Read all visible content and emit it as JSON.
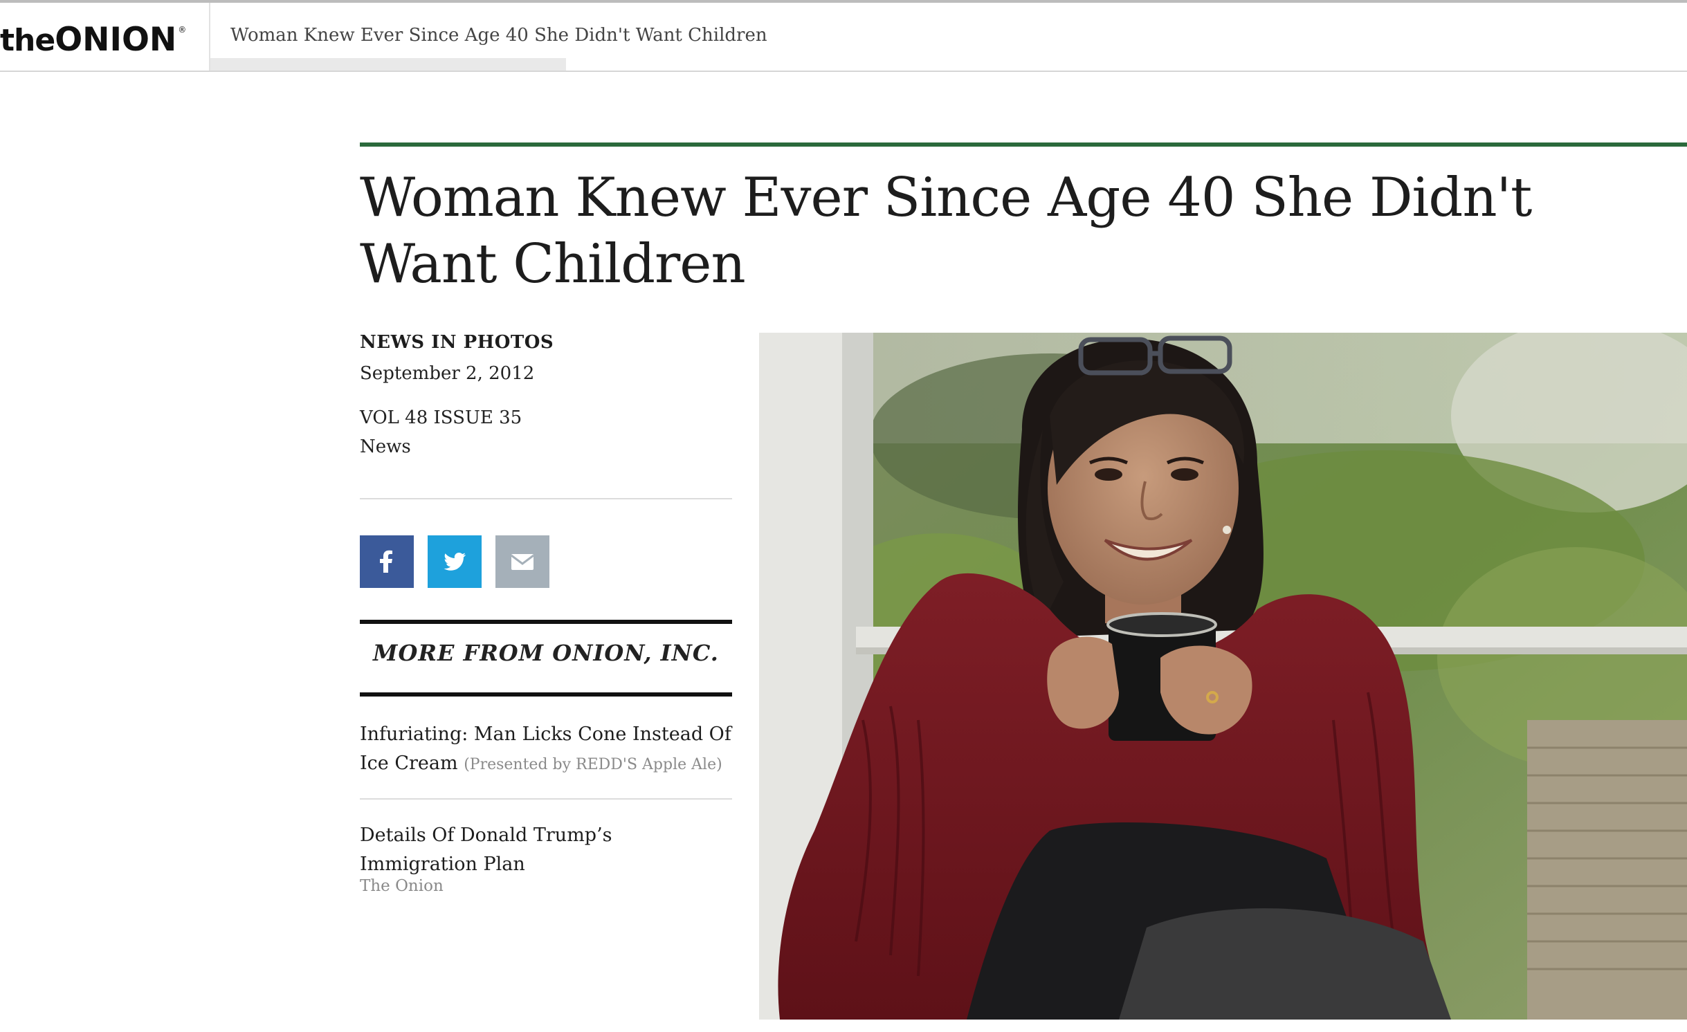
{
  "header": {
    "logo_the": "the",
    "logo_onion": "ONION",
    "logo_registered": "®",
    "page_title": "Woman Knew Ever Since Age 40 She Didn't Want Children"
  },
  "article": {
    "headline": "Woman Knew Ever Since Age 40 She Didn't Want Children",
    "section": "NEWS IN PHOTOS",
    "date": "September 2, 2012",
    "volume_issue": "VOL 48 ISSUE 35",
    "category": "News",
    "accent_color": "#2b6a3c"
  },
  "share": {
    "facebook_icon": "facebook-icon",
    "twitter_icon": "twitter-icon",
    "email_icon": "email-icon",
    "facebook_color": "#3b5a9a",
    "twitter_color": "#1ea1dc",
    "email_color": "#a5b0b9"
  },
  "more_from": {
    "heading": "MORE FROM ONION, INC.",
    "stories": [
      {
        "title": "Infuriating: Man Licks Cone Instead Of Ice Cream",
        "sponsor": "(Presented by REDD'S Apple Ale)"
      },
      {
        "title": "Details Of Donald Trump’s Immigration Plan",
        "source": "The Onion"
      }
    ]
  }
}
